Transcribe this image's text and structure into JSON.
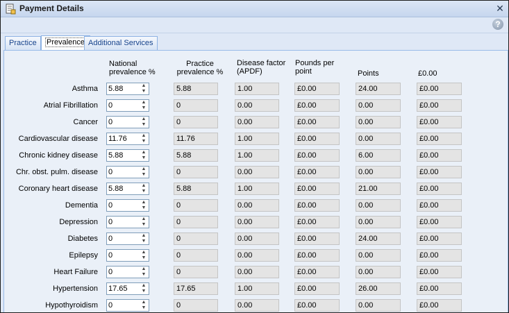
{
  "window": {
    "title": "Payment Details",
    "close_icon": "close-icon",
    "help_label": "?"
  },
  "tabs": [
    {
      "label": "Practice",
      "active": false
    },
    {
      "label": "Prevalence",
      "active": true
    },
    {
      "label": "Additional Services",
      "active": false
    }
  ],
  "headers": {
    "national": [
      "National",
      "prevalence %"
    ],
    "practice": [
      "Practice",
      "prevalence %"
    ],
    "factor": [
      "Disease factor",
      "(APDF)"
    ],
    "pounds": [
      "Pounds per",
      "point"
    ],
    "points": "Points",
    "total": "£0.00"
  },
  "rows": [
    {
      "label": "Asthma",
      "national": "5.88",
      "practice": "5.88",
      "factor": "1.00",
      "pounds": "£0.00",
      "points": "24.00",
      "total": "£0.00"
    },
    {
      "label": "Atrial Fibrillation",
      "national": "0",
      "practice": "0",
      "factor": "0.00",
      "pounds": "£0.00",
      "points": "0.00",
      "total": "£0.00"
    },
    {
      "label": "Cancer",
      "national": "0",
      "practice": "0",
      "factor": "0.00",
      "pounds": "£0.00",
      "points": "0.00",
      "total": "£0.00"
    },
    {
      "label": "Cardiovascular disease",
      "national": "11.76",
      "practice": "11.76",
      "factor": "1.00",
      "pounds": "£0.00",
      "points": "0.00",
      "total": "£0.00"
    },
    {
      "label": "Chronic kidney disease",
      "national": "5.88",
      "practice": "5.88",
      "factor": "1.00",
      "pounds": "£0.00",
      "points": "6.00",
      "total": "£0.00"
    },
    {
      "label": "Chr. obst. pulm. disease",
      "national": "0",
      "practice": "0",
      "factor": "0.00",
      "pounds": "£0.00",
      "points": "0.00",
      "total": "£0.00"
    },
    {
      "label": "Coronary heart disease",
      "national": "5.88",
      "practice": "5.88",
      "factor": "1.00",
      "pounds": "£0.00",
      "points": "21.00",
      "total": "£0.00"
    },
    {
      "label": "Dementia",
      "national": "0",
      "practice": "0",
      "factor": "0.00",
      "pounds": "£0.00",
      "points": "0.00",
      "total": "£0.00"
    },
    {
      "label": "Depression",
      "national": "0",
      "practice": "0",
      "factor": "0.00",
      "pounds": "£0.00",
      "points": "0.00",
      "total": "£0.00"
    },
    {
      "label": "Diabetes",
      "national": "0",
      "practice": "0",
      "factor": "0.00",
      "pounds": "£0.00",
      "points": "24.00",
      "total": "£0.00"
    },
    {
      "label": "Epilepsy",
      "national": "0",
      "practice": "0",
      "factor": "0.00",
      "pounds": "£0.00",
      "points": "0.00",
      "total": "£0.00"
    },
    {
      "label": "Heart Failure",
      "national": "0",
      "practice": "0",
      "factor": "0.00",
      "pounds": "£0.00",
      "points": "0.00",
      "total": "£0.00"
    },
    {
      "label": "Hypertension",
      "national": "17.65",
      "practice": "17.65",
      "factor": "1.00",
      "pounds": "£0.00",
      "points": "26.00",
      "total": "£0.00"
    },
    {
      "label": "Hypothyroidism",
      "national": "0",
      "practice": "0",
      "factor": "0.00",
      "pounds": "£0.00",
      "points": "0.00",
      "total": "£0.00"
    }
  ]
}
